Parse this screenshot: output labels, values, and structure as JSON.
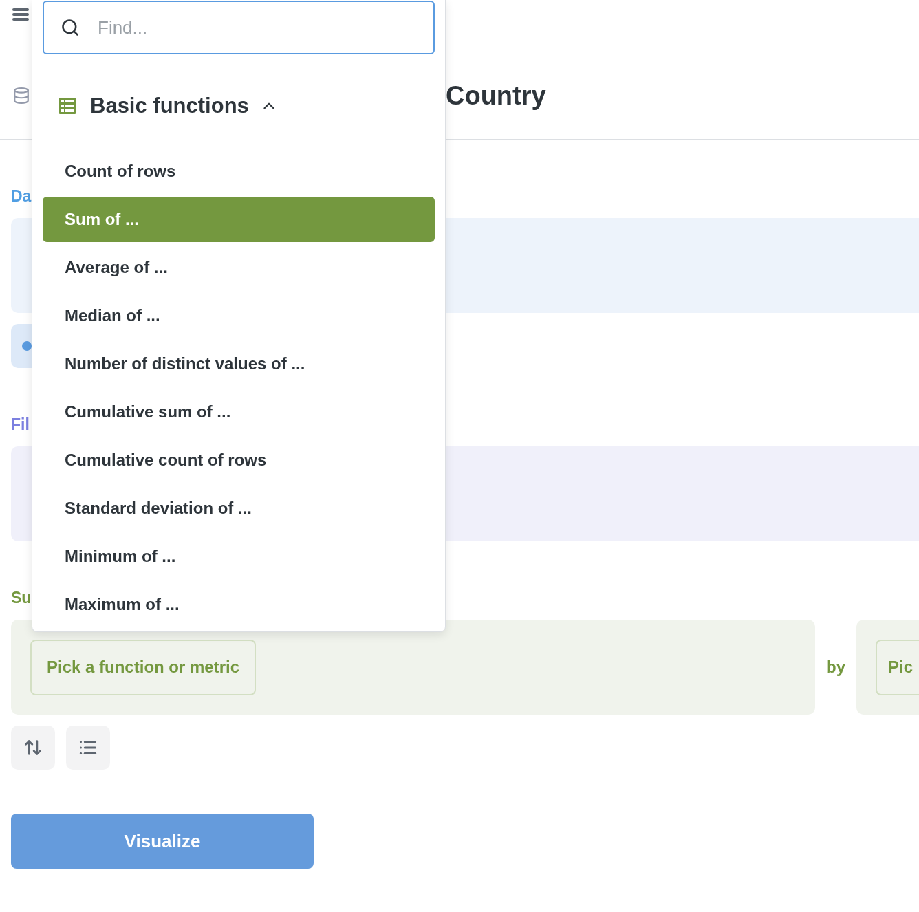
{
  "header": {
    "title": "Country"
  },
  "sections": [
    {
      "kind": "data",
      "label": "Da"
    },
    {
      "kind": "filter",
      "label": "Fil"
    },
    {
      "kind": "summarize",
      "label": "Su",
      "metric_button": "Pick a function or metric",
      "joiner": "by",
      "group_button": "Pic"
    }
  ],
  "visualize_button": "Visualize",
  "popover": {
    "search": {
      "placeholder": "Find..."
    },
    "group": {
      "title": "Basic functions",
      "expanded": true
    },
    "items": [
      {
        "label": "Count of rows",
        "selected": false
      },
      {
        "label": "Sum of ...",
        "selected": true
      },
      {
        "label": "Average of ...",
        "selected": false
      },
      {
        "label": "Median of ...",
        "selected": false
      },
      {
        "label": "Number of distinct values of ...",
        "selected": false
      },
      {
        "label": "Cumulative sum of ...",
        "selected": false
      },
      {
        "label": "Cumulative count of rows",
        "selected": false
      },
      {
        "label": "Standard deviation of ...",
        "selected": false
      },
      {
        "label": "Minimum of ...",
        "selected": false
      },
      {
        "label": "Maximum of ...",
        "selected": false
      }
    ]
  }
}
